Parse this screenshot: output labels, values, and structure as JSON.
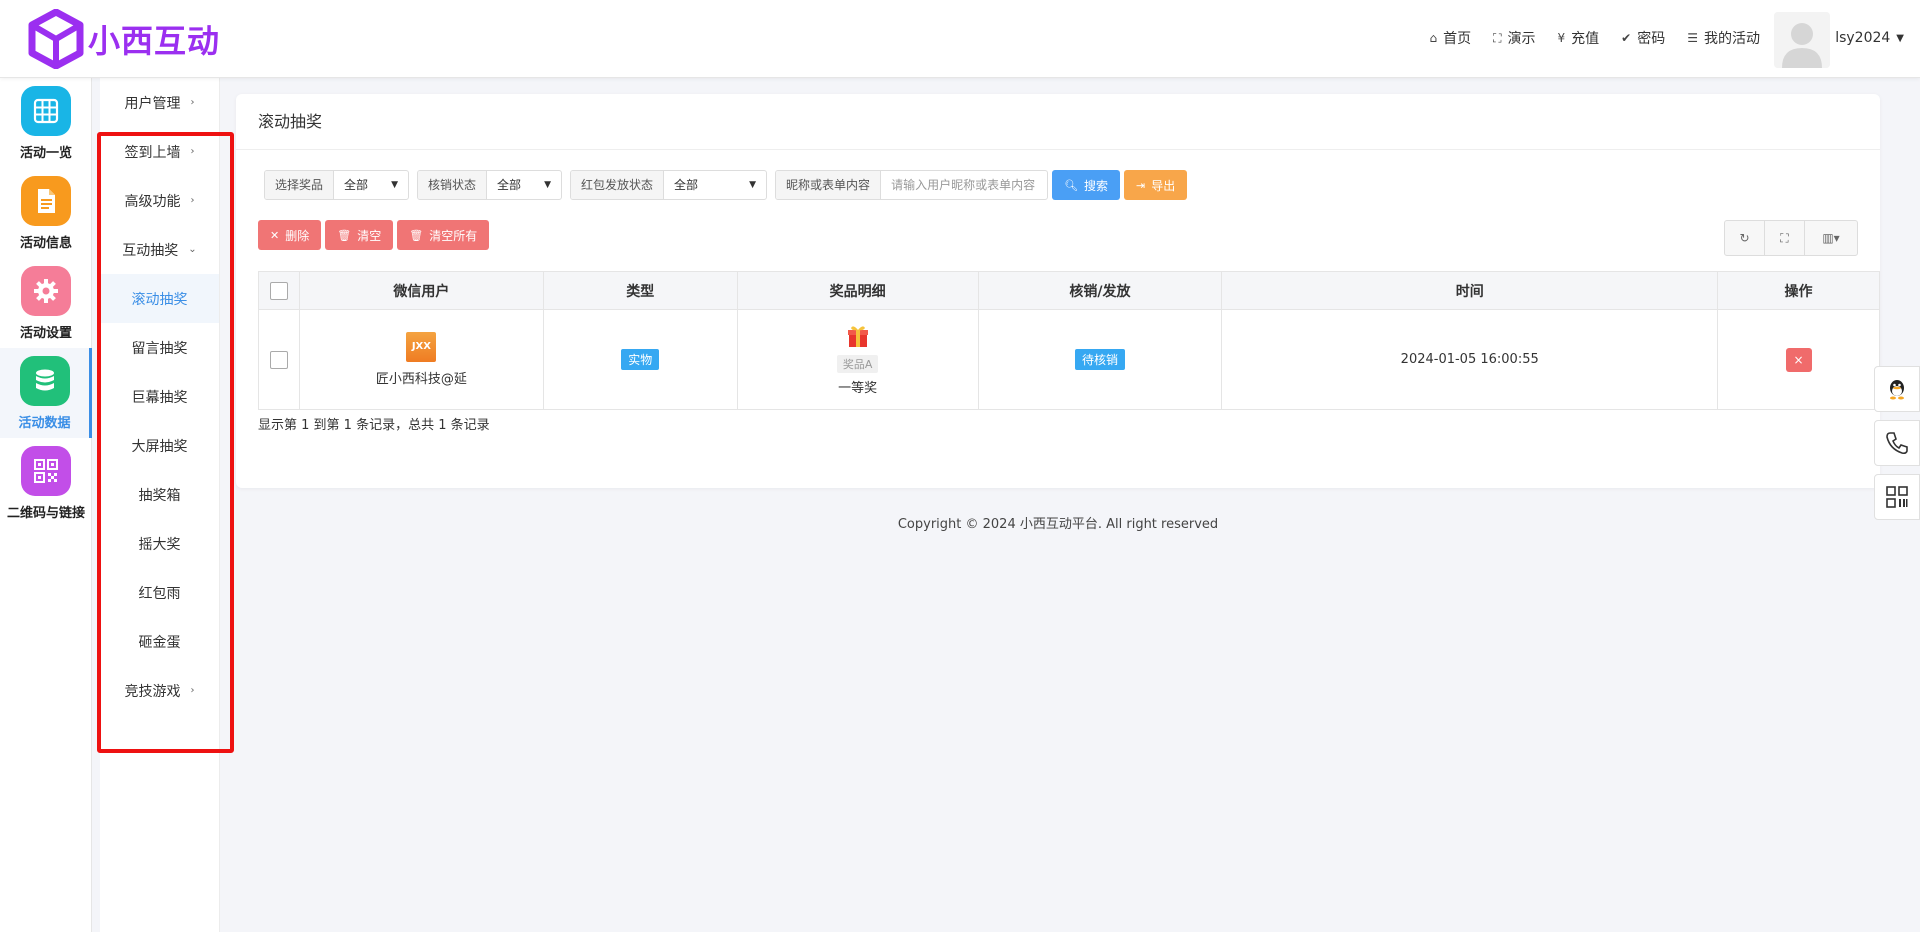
{
  "brand": {
    "name": "小西互动",
    "color": "#9b2ff0"
  },
  "topnav": [
    {
      "label": "首页",
      "icon": "home-icon",
      "glyph": "⌂"
    },
    {
      "label": "演示",
      "icon": "fullscreen-icon",
      "glyph": "⛶"
    },
    {
      "label": "充值",
      "icon": "yen-icon",
      "glyph": "¥"
    },
    {
      "label": "密码",
      "icon": "check-circle-icon",
      "glyph": "✔"
    },
    {
      "label": "我的活动",
      "icon": "list-icon",
      "glyph": "☰"
    }
  ],
  "user": {
    "name": "lsy2024"
  },
  "rail": [
    {
      "label": "活动一览",
      "color": "#19b5e6",
      "icon": "grid-icon"
    },
    {
      "label": "活动信息",
      "color": "#f89a1e",
      "icon": "document-icon"
    },
    {
      "label": "活动设置",
      "color": "#f57d98",
      "icon": "gear-icon"
    },
    {
      "label": "活动数据",
      "color": "#21c07a",
      "icon": "database-icon",
      "active": true
    },
    {
      "label": "二维码与链接",
      "color": "#c24ee8",
      "icon": "qrcode-icon"
    }
  ],
  "submenu": [
    {
      "label": "用户管理",
      "arrow": "›"
    },
    {
      "label": "签到上墙",
      "arrow": "›"
    },
    {
      "label": "高级功能",
      "arrow": "›"
    },
    {
      "label": "互动抽奖",
      "arrow": "⌄"
    },
    {
      "label": "滚动抽奖",
      "arrow": "",
      "active": true
    },
    {
      "label": "留言抽奖",
      "arrow": ""
    },
    {
      "label": "巨幕抽奖",
      "arrow": ""
    },
    {
      "label": "大屏抽奖",
      "arrow": ""
    },
    {
      "label": "抽奖箱",
      "arrow": ""
    },
    {
      "label": "摇大奖",
      "arrow": ""
    },
    {
      "label": "红包雨",
      "arrow": ""
    },
    {
      "label": "砸金蛋",
      "arrow": ""
    },
    {
      "label": "竞技游戏",
      "arrow": "›"
    }
  ],
  "panel": {
    "title": "滚动抽奖",
    "filters": {
      "prize_label": "选择奖品",
      "prize_value": "全部",
      "verify_label": "核销状态",
      "verify_value": "全部",
      "redpack_label": "红包发放状态",
      "redpack_value": "全部",
      "search_label": "昵称或表单内容",
      "search_placeholder": "请输入用户昵称或表单内容",
      "search_button": "搜索",
      "export_button": "导出"
    },
    "actions": {
      "delete": "删除",
      "clear": "清空",
      "clear_all": "清空所有"
    },
    "tools": {
      "refresh": "↻",
      "fullscreen": "⛶",
      "columns": "▥▾"
    },
    "table": {
      "headers": [
        "微信用户",
        "类型",
        "奖品明细",
        "核销/发放",
        "时间",
        "操作"
      ],
      "rows": [
        {
          "avatar_text": "JXX",
          "user": "匠小西科技@延",
          "type": "实物",
          "prize_tag": "奖品A",
          "prize_name": "一等奖",
          "status": "待核销",
          "time": "2024-01-05 16:00:55",
          "op": "×"
        }
      ]
    },
    "pager": "显示第 1 到第 1 条记录，总共 1 条记录"
  },
  "footer": "Copyright © 2024 小西互动平台. All right reserved"
}
